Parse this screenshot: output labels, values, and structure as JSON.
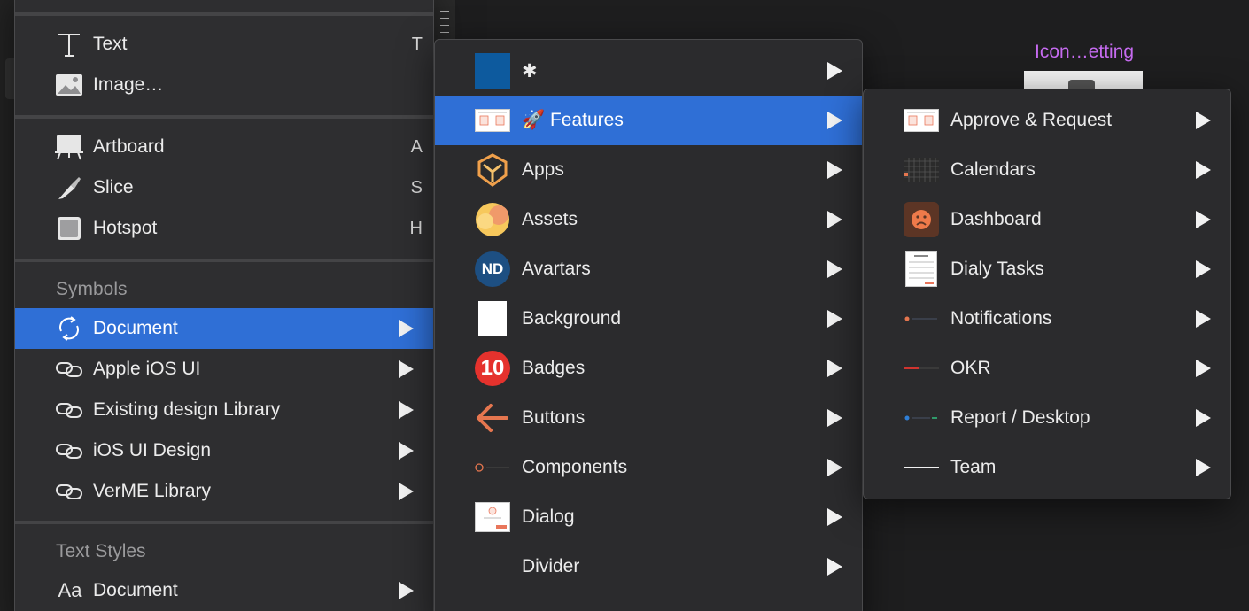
{
  "artboard": {
    "title": "Icon…etting"
  },
  "menu1": {
    "items": [
      {
        "label": "Text",
        "shortcut": "T"
      },
      {
        "label": "Image…"
      },
      {
        "label": "Artboard",
        "shortcut": "A"
      },
      {
        "label": "Slice",
        "shortcut": "S"
      },
      {
        "label": "Hotspot",
        "shortcut": "H"
      }
    ],
    "symbols_header": "Symbols",
    "symbols": [
      {
        "label": "Document"
      },
      {
        "label": "Apple iOS UI"
      },
      {
        "label": "Existing design Library"
      },
      {
        "label": "iOS UI Design"
      },
      {
        "label": "VerME Library"
      }
    ],
    "text_styles_header": "Text Styles",
    "text_styles": [
      {
        "label": "Document",
        "icon_text": "Aa"
      }
    ]
  },
  "menu2": {
    "items": [
      {
        "label": "✱"
      },
      {
        "label": "🚀 Features"
      },
      {
        "label": "Apps"
      },
      {
        "label": "Assets"
      },
      {
        "label": "Avartars",
        "icon_text": "ND"
      },
      {
        "label": "Background"
      },
      {
        "label": "Badges",
        "icon_text": "10"
      },
      {
        "label": "Buttons"
      },
      {
        "label": "Components"
      },
      {
        "label": "Dialog"
      },
      {
        "label": "Divider"
      }
    ]
  },
  "menu3": {
    "items": [
      {
        "label": "Approve & Request"
      },
      {
        "label": "Calendars"
      },
      {
        "label": "Dashboard"
      },
      {
        "label": "Dialy Tasks"
      },
      {
        "label": "Notifications"
      },
      {
        "label": "OKR"
      },
      {
        "label": "Report / Desktop"
      },
      {
        "label": "Team"
      }
    ]
  },
  "colors": {
    "highlight": "#2f6fd6",
    "artboard_title": "#c66bf0"
  }
}
